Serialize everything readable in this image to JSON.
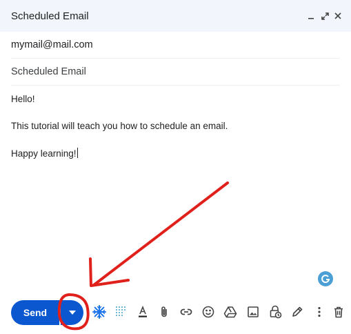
{
  "window": {
    "title": "Scheduled Email"
  },
  "compose": {
    "to": "mymail@mail.com",
    "subject": "Scheduled Email",
    "body": [
      "Hello!",
      "This tutorial will teach you how to schedule an email.",
      "Happy learning!"
    ]
  },
  "toolbar": {
    "send_label": "Send",
    "icons": [
      "snowflake-icon",
      "dotted-square-icon",
      "text-color-icon",
      "attach-icon",
      "link-icon",
      "emoji-icon",
      "drive-icon",
      "image-icon",
      "lock-clock-icon",
      "pen-icon",
      "more-icon",
      "trash-icon"
    ]
  },
  "annotation": {
    "color": "#e0201b"
  },
  "colors": {
    "accent": "#0b57d0",
    "header_bg": "#f2f6fc"
  }
}
